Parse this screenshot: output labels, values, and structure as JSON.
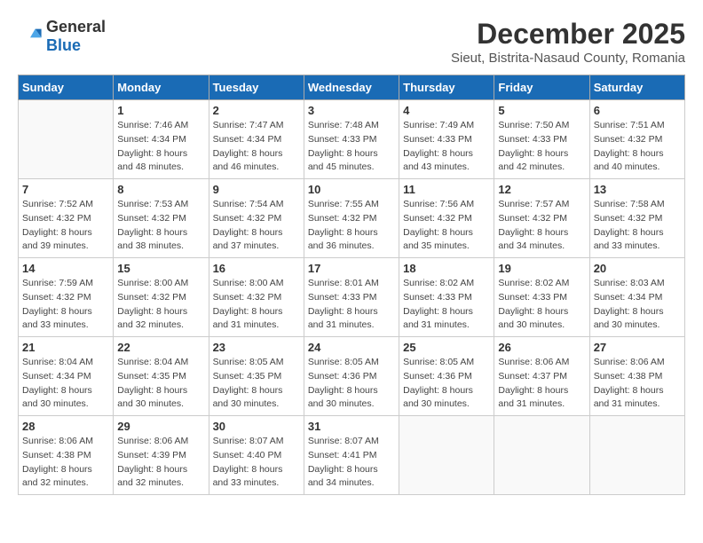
{
  "logo": {
    "general": "General",
    "blue": "Blue"
  },
  "title": "December 2025",
  "subtitle": "Sieut, Bistrita-Nasaud County, Romania",
  "weekdays": [
    "Sunday",
    "Monday",
    "Tuesday",
    "Wednesday",
    "Thursday",
    "Friday",
    "Saturday"
  ],
  "weeks": [
    [
      {
        "day": "",
        "sunrise": "",
        "sunset": "",
        "daylight": ""
      },
      {
        "day": "1",
        "sunrise": "Sunrise: 7:46 AM",
        "sunset": "Sunset: 4:34 PM",
        "daylight": "Daylight: 8 hours and 48 minutes."
      },
      {
        "day": "2",
        "sunrise": "Sunrise: 7:47 AM",
        "sunset": "Sunset: 4:34 PM",
        "daylight": "Daylight: 8 hours and 46 minutes."
      },
      {
        "day": "3",
        "sunrise": "Sunrise: 7:48 AM",
        "sunset": "Sunset: 4:33 PM",
        "daylight": "Daylight: 8 hours and 45 minutes."
      },
      {
        "day": "4",
        "sunrise": "Sunrise: 7:49 AM",
        "sunset": "Sunset: 4:33 PM",
        "daylight": "Daylight: 8 hours and 43 minutes."
      },
      {
        "day": "5",
        "sunrise": "Sunrise: 7:50 AM",
        "sunset": "Sunset: 4:33 PM",
        "daylight": "Daylight: 8 hours and 42 minutes."
      },
      {
        "day": "6",
        "sunrise": "Sunrise: 7:51 AM",
        "sunset": "Sunset: 4:32 PM",
        "daylight": "Daylight: 8 hours and 40 minutes."
      }
    ],
    [
      {
        "day": "7",
        "sunrise": "Sunrise: 7:52 AM",
        "sunset": "Sunset: 4:32 PM",
        "daylight": "Daylight: 8 hours and 39 minutes."
      },
      {
        "day": "8",
        "sunrise": "Sunrise: 7:53 AM",
        "sunset": "Sunset: 4:32 PM",
        "daylight": "Daylight: 8 hours and 38 minutes."
      },
      {
        "day": "9",
        "sunrise": "Sunrise: 7:54 AM",
        "sunset": "Sunset: 4:32 PM",
        "daylight": "Daylight: 8 hours and 37 minutes."
      },
      {
        "day": "10",
        "sunrise": "Sunrise: 7:55 AM",
        "sunset": "Sunset: 4:32 PM",
        "daylight": "Daylight: 8 hours and 36 minutes."
      },
      {
        "day": "11",
        "sunrise": "Sunrise: 7:56 AM",
        "sunset": "Sunset: 4:32 PM",
        "daylight": "Daylight: 8 hours and 35 minutes."
      },
      {
        "day": "12",
        "sunrise": "Sunrise: 7:57 AM",
        "sunset": "Sunset: 4:32 PM",
        "daylight": "Daylight: 8 hours and 34 minutes."
      },
      {
        "day": "13",
        "sunrise": "Sunrise: 7:58 AM",
        "sunset": "Sunset: 4:32 PM",
        "daylight": "Daylight: 8 hours and 33 minutes."
      }
    ],
    [
      {
        "day": "14",
        "sunrise": "Sunrise: 7:59 AM",
        "sunset": "Sunset: 4:32 PM",
        "daylight": "Daylight: 8 hours and 33 minutes."
      },
      {
        "day": "15",
        "sunrise": "Sunrise: 8:00 AM",
        "sunset": "Sunset: 4:32 PM",
        "daylight": "Daylight: 8 hours and 32 minutes."
      },
      {
        "day": "16",
        "sunrise": "Sunrise: 8:00 AM",
        "sunset": "Sunset: 4:32 PM",
        "daylight": "Daylight: 8 hours and 31 minutes."
      },
      {
        "day": "17",
        "sunrise": "Sunrise: 8:01 AM",
        "sunset": "Sunset: 4:33 PM",
        "daylight": "Daylight: 8 hours and 31 minutes."
      },
      {
        "day": "18",
        "sunrise": "Sunrise: 8:02 AM",
        "sunset": "Sunset: 4:33 PM",
        "daylight": "Daylight: 8 hours and 31 minutes."
      },
      {
        "day": "19",
        "sunrise": "Sunrise: 8:02 AM",
        "sunset": "Sunset: 4:33 PM",
        "daylight": "Daylight: 8 hours and 30 minutes."
      },
      {
        "day": "20",
        "sunrise": "Sunrise: 8:03 AM",
        "sunset": "Sunset: 4:34 PM",
        "daylight": "Daylight: 8 hours and 30 minutes."
      }
    ],
    [
      {
        "day": "21",
        "sunrise": "Sunrise: 8:04 AM",
        "sunset": "Sunset: 4:34 PM",
        "daylight": "Daylight: 8 hours and 30 minutes."
      },
      {
        "day": "22",
        "sunrise": "Sunrise: 8:04 AM",
        "sunset": "Sunset: 4:35 PM",
        "daylight": "Daylight: 8 hours and 30 minutes."
      },
      {
        "day": "23",
        "sunrise": "Sunrise: 8:05 AM",
        "sunset": "Sunset: 4:35 PM",
        "daylight": "Daylight: 8 hours and 30 minutes."
      },
      {
        "day": "24",
        "sunrise": "Sunrise: 8:05 AM",
        "sunset": "Sunset: 4:36 PM",
        "daylight": "Daylight: 8 hours and 30 minutes."
      },
      {
        "day": "25",
        "sunrise": "Sunrise: 8:05 AM",
        "sunset": "Sunset: 4:36 PM",
        "daylight": "Daylight: 8 hours and 30 minutes."
      },
      {
        "day": "26",
        "sunrise": "Sunrise: 8:06 AM",
        "sunset": "Sunset: 4:37 PM",
        "daylight": "Daylight: 8 hours and 31 minutes."
      },
      {
        "day": "27",
        "sunrise": "Sunrise: 8:06 AM",
        "sunset": "Sunset: 4:38 PM",
        "daylight": "Daylight: 8 hours and 31 minutes."
      }
    ],
    [
      {
        "day": "28",
        "sunrise": "Sunrise: 8:06 AM",
        "sunset": "Sunset: 4:38 PM",
        "daylight": "Daylight: 8 hours and 32 minutes."
      },
      {
        "day": "29",
        "sunrise": "Sunrise: 8:06 AM",
        "sunset": "Sunset: 4:39 PM",
        "daylight": "Daylight: 8 hours and 32 minutes."
      },
      {
        "day": "30",
        "sunrise": "Sunrise: 8:07 AM",
        "sunset": "Sunset: 4:40 PM",
        "daylight": "Daylight: 8 hours and 33 minutes."
      },
      {
        "day": "31",
        "sunrise": "Sunrise: 8:07 AM",
        "sunset": "Sunset: 4:41 PM",
        "daylight": "Daylight: 8 hours and 34 minutes."
      },
      {
        "day": "",
        "sunrise": "",
        "sunset": "",
        "daylight": ""
      },
      {
        "day": "",
        "sunrise": "",
        "sunset": "",
        "daylight": ""
      },
      {
        "day": "",
        "sunrise": "",
        "sunset": "",
        "daylight": ""
      }
    ]
  ]
}
